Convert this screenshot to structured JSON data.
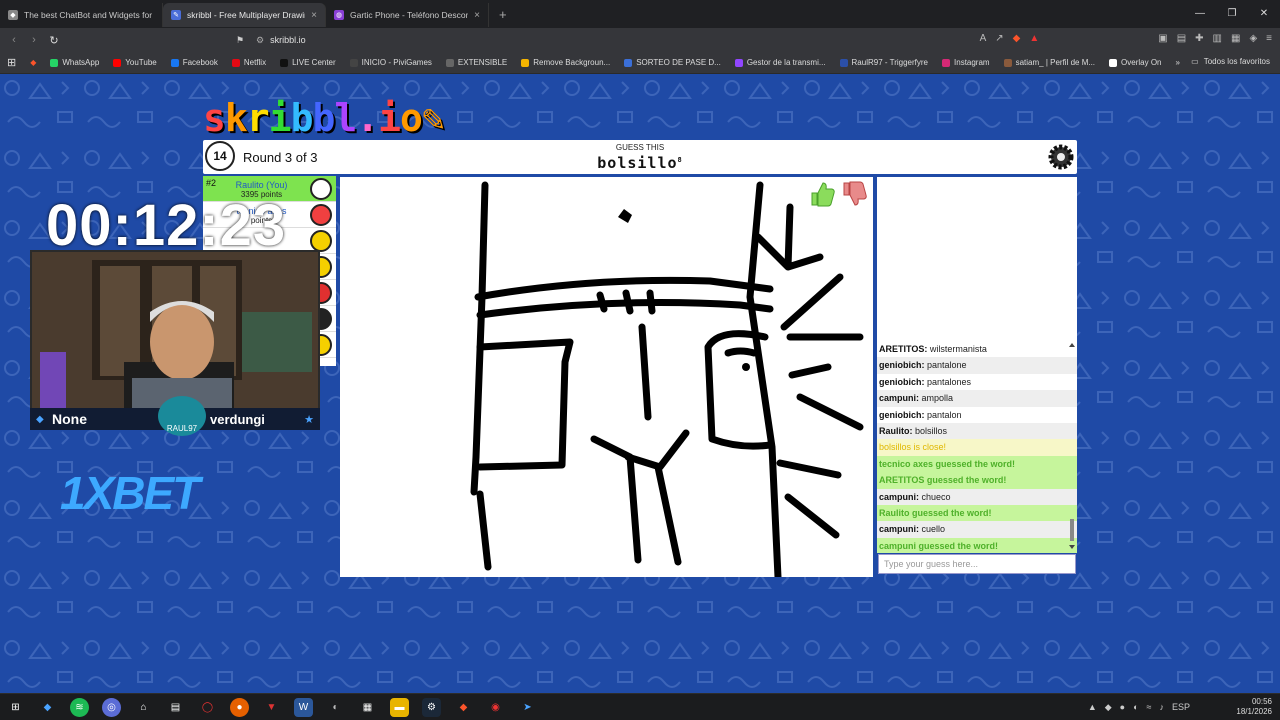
{
  "browser": {
    "tabs": [
      {
        "title": "The best ChatBot and Widgets for Ki",
        "close": "×"
      },
      {
        "title": "skribbl - Free Multiplayer Drawin",
        "close": "×"
      },
      {
        "title": "Gartic Phone - Teléfono Descompue",
        "close": "×"
      }
    ],
    "new_tab": "+",
    "url": "skribbl.io",
    "bookmarks": [
      {
        "label": "WhatsApp",
        "color": "#25d366"
      },
      {
        "label": "YouTube",
        "color": "#ff0000"
      },
      {
        "label": "Facebook",
        "color": "#1877f2"
      },
      {
        "label": "Netflix",
        "color": "#e50914"
      },
      {
        "label": "LIVE Center",
        "color": "#111111"
      },
      {
        "label": "INICIO - PiviGames",
        "color": "#444444"
      },
      {
        "label": "EXTENSIBLE",
        "color": "#666666"
      },
      {
        "label": "Remove Backgroun...",
        "color": "#f5b400"
      },
      {
        "label": "SORTEO DE PASE D...",
        "color": "#3b6fd8"
      },
      {
        "label": "Gestor de la transmi...",
        "color": "#9146ff"
      },
      {
        "label": "RaulR97 - Triggerfyre",
        "color": "#2b4fa8"
      },
      {
        "label": "Instagram",
        "color": "#d62976"
      },
      {
        "label": "satiam_ | Perfil de M...",
        "color": "#8a5a3c"
      },
      {
        "label": "Overlay On",
        "color": "#ffffff"
      }
    ],
    "bookmarks_more": "»",
    "all_favorites": "Todos los favoritos"
  },
  "game": {
    "logo": "skribbl.io",
    "timer": "14",
    "round": "Round 3 of 3",
    "guess_label": "GUESS THIS",
    "word": "bolsillo",
    "word_length": "8",
    "players": [
      {
        "rank": "#2",
        "name": "Raulito (You)",
        "points": "3395 points",
        "avatar": "#ffffff"
      },
      {
        "rank": "",
        "name": "tecnico axes",
        "points": "points",
        "avatar": "#f04040"
      },
      {
        "rank": "",
        "name": "",
        "points": "",
        "avatar": "#f5d000"
      },
      {
        "rank": "",
        "name": "",
        "points": "",
        "avatar": "#f5d000"
      },
      {
        "rank": "",
        "name": "",
        "points": "",
        "avatar": "#e03030"
      },
      {
        "rank": "",
        "name": "",
        "points": "",
        "avatar": "#222222"
      },
      {
        "rank": "",
        "name": "",
        "points": "",
        "avatar": "#f5d000"
      }
    ],
    "chat": [
      {
        "user": "ARETITOS:",
        "text": "wilstermanista",
        "kind": "msg"
      },
      {
        "user": "geniobich:",
        "text": "pantalone",
        "kind": "msg"
      },
      {
        "user": "geniobich:",
        "text": "pantalones",
        "kind": "msg"
      },
      {
        "user": "campuni:",
        "text": "ampolla",
        "kind": "msg"
      },
      {
        "user": "geniobich:",
        "text": "pantalon",
        "kind": "msg"
      },
      {
        "user": "Raulito:",
        "text": "bolsillos",
        "kind": "msg"
      },
      {
        "user": "",
        "text": "bolsillos is close!",
        "kind": "close"
      },
      {
        "user": "",
        "text": "tecnico axes guessed the word!",
        "kind": "ok"
      },
      {
        "user": "",
        "text": "ARETITOS guessed the word!",
        "kind": "ok"
      },
      {
        "user": "campuni:",
        "text": "chueco",
        "kind": "msg"
      },
      {
        "user": "",
        "text": "Raulito guessed the word!",
        "kind": "ok"
      },
      {
        "user": "campuni:",
        "text": "cuello",
        "kind": "msg"
      },
      {
        "user": "",
        "text": "campuni guessed the word!",
        "kind": "ok"
      }
    ],
    "chat_placeholder": "Type your guess here..."
  },
  "stream": {
    "timer": "00:12:23",
    "name_left": "None",
    "name_right": "verdungi",
    "sponsor": "1XBET"
  },
  "taskbar": {
    "time": "00:56",
    "date": "18/1/2026",
    "lang": "ESP"
  }
}
